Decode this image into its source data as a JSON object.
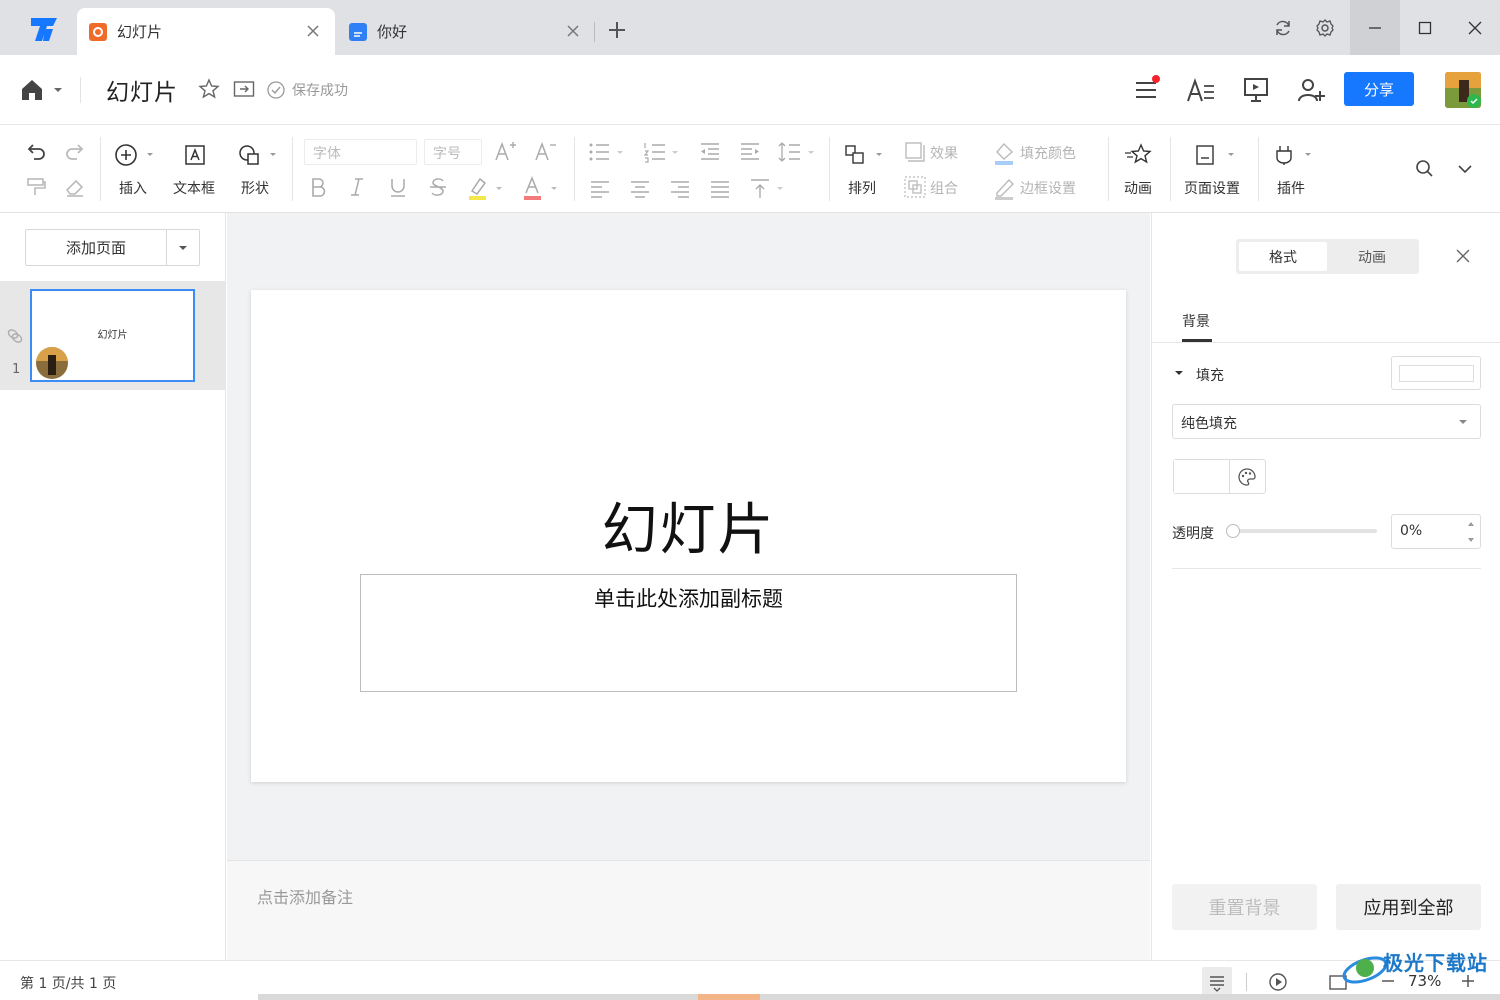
{
  "tabs": [
    {
      "label": "幻灯片",
      "color": "#f06b2a"
    },
    {
      "label": "你好",
      "color": "#2f7ff5"
    }
  ],
  "header": {
    "title": "幻灯片",
    "save_status": "保存成功",
    "share_label": "分享"
  },
  "ribbon": {
    "insert": "插入",
    "textbox": "文本框",
    "shape": "形状",
    "font": "字体",
    "font_size": "字号",
    "arrange": "排列",
    "effect": "效果",
    "group": "组合",
    "fill_color": "填充颜色",
    "border": "边框设置",
    "animation": "动画",
    "page_setup": "页面设置",
    "plugin": "插件"
  },
  "left_panel": {
    "add_page": "添加页面",
    "thumb_title": "幻灯片",
    "thumb_number": "1"
  },
  "slide": {
    "title": "幻灯片",
    "subtitle": "单击此处添加副标题"
  },
  "notes_placeholder": "点击添加备注",
  "right_panel": {
    "tab_format": "格式",
    "tab_animation": "动画",
    "section": "背景",
    "fill_label": "填充",
    "fill_type": "纯色填充",
    "transparency_label": "透明度",
    "transparency_value": "0%",
    "reset_button": "重置背景",
    "apply_button": "应用到全部"
  },
  "statusbar": {
    "page_count": "第 1 页/共 1 页",
    "zoom": "73%"
  },
  "watermark": "极光下载站",
  "colors": {
    "accent": "#1677ff",
    "selected": "#3b8cf5"
  }
}
